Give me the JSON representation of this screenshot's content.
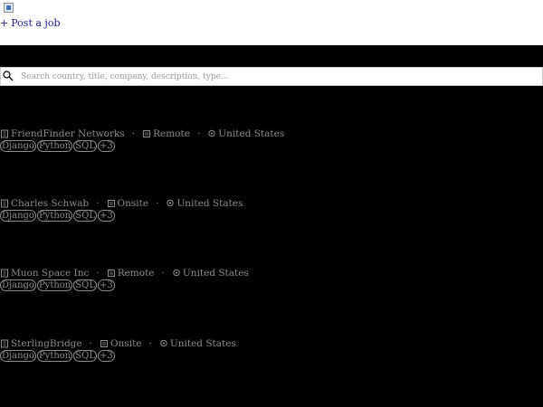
{
  "header": {
    "post_job_label": "Post a job",
    "post_job_icon": "plus-icon",
    "logo_icon": "app-logo-icon"
  },
  "search": {
    "placeholder": "Search country, title, company, description, type...",
    "value": ""
  },
  "jobs": [
    {
      "company": "FriendFinder Networks",
      "work_type": "Remote",
      "location": "United States",
      "tags": [
        "Django",
        "Python",
        "SQL",
        "+3"
      ]
    },
    {
      "company": "Charles Schwab",
      "work_type": "Onsite",
      "location": "United States",
      "tags": [
        "Django",
        "Python",
        "SQL",
        "+3"
      ]
    },
    {
      "company": "Muon Space Inc",
      "work_type": "Remote",
      "location": "United States",
      "tags": [
        "Django",
        "Python",
        "SQL",
        "+3"
      ]
    },
    {
      "company": "SterlingBridge",
      "work_type": "Onsite",
      "location": "United States",
      "tags": [
        "Django",
        "Python",
        "SQL",
        "+3"
      ]
    }
  ],
  "separator": "·",
  "colors": {
    "background": "#000000",
    "header_bg": "#ffffff",
    "link": "#1a1a8c",
    "muted_text": "#8e8e8e"
  }
}
